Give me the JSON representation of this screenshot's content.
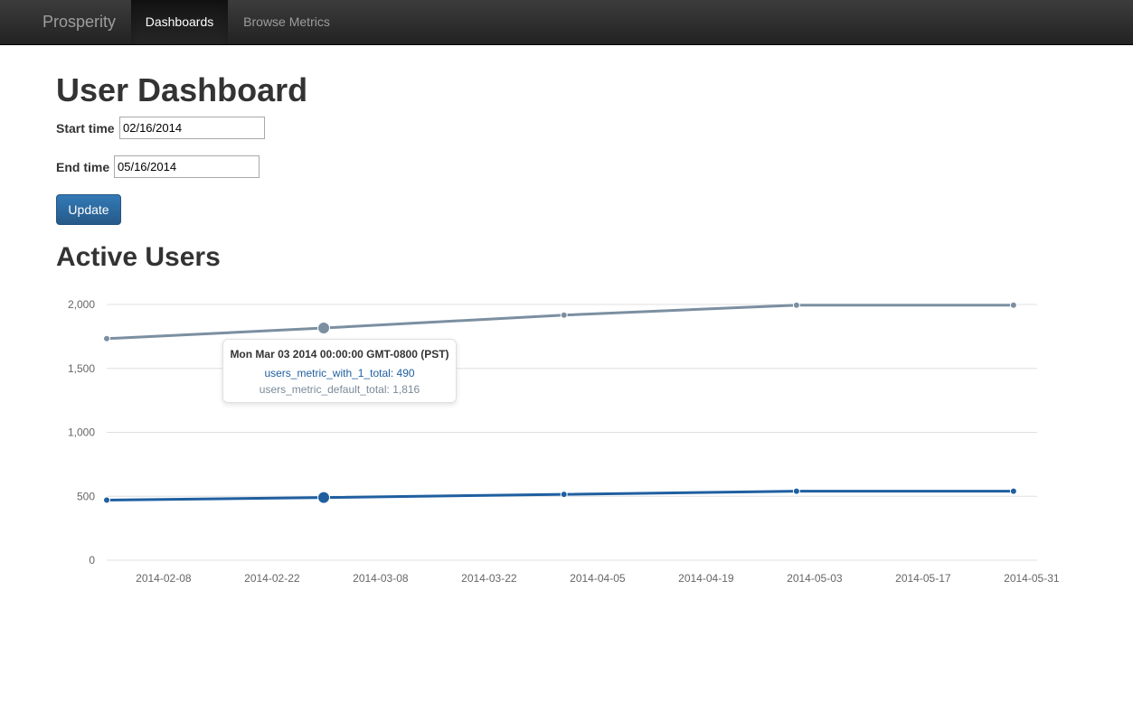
{
  "nav": {
    "brand": "Prosperity",
    "items": [
      {
        "label": "Dashboards",
        "active": true
      },
      {
        "label": "Browse Metrics",
        "active": false
      }
    ]
  },
  "page": {
    "title": "User Dashboard",
    "start_label": "Start time",
    "start_value": "02/16/2014",
    "end_label": "End time",
    "end_value": "05/16/2014",
    "update_label": "Update"
  },
  "chart_heading": "Active Users",
  "tooltip": {
    "title": "Mon Mar 03 2014 00:00:00 GMT-0800 (PST)",
    "row1_name": "users_metric_with_1_total",
    "row1_value": "490",
    "row2_name": "users_metric_default_total",
    "row2_value": "1,816"
  },
  "colors": {
    "series_with_1": "#1f5fa0",
    "series_default": "#7b8fa1",
    "grid": "#e0e0e0"
  },
  "chart_data": {
    "type": "line",
    "title": "Active Users",
    "xlabel": "",
    "ylabel": "",
    "ylim": [
      0,
      2000
    ],
    "y_ticks": [
      "0",
      "500",
      "1,000",
      "1,500",
      "2,000"
    ],
    "y_tick_values": [
      0,
      500,
      1000,
      1500,
      2000
    ],
    "x_ticks": [
      "2014-02-08",
      "2014-02-22",
      "2014-03-08",
      "2014-03-22",
      "2014-04-05",
      "2014-04-19",
      "2014-05-03",
      "2014-05-17",
      "2014-05-31"
    ],
    "xlim": [
      "2014-02-03",
      "2014-05-31"
    ],
    "grid": true,
    "series": [
      {
        "name": "users_metric_default_total",
        "x": [
          "2014-02-03",
          "2014-03-03",
          "2014-04-03",
          "2014-05-03",
          "2014-05-31"
        ],
        "values": [
          1733,
          1816,
          1917,
          1995,
          1995
        ],
        "highlight_index": 1
      },
      {
        "name": "users_metric_with_1_total",
        "x": [
          "2014-02-03",
          "2014-03-03",
          "2014-04-03",
          "2014-05-03",
          "2014-05-31"
        ],
        "values": [
          470,
          490,
          515,
          540,
          540
        ],
        "highlight_index": 1
      }
    ]
  }
}
